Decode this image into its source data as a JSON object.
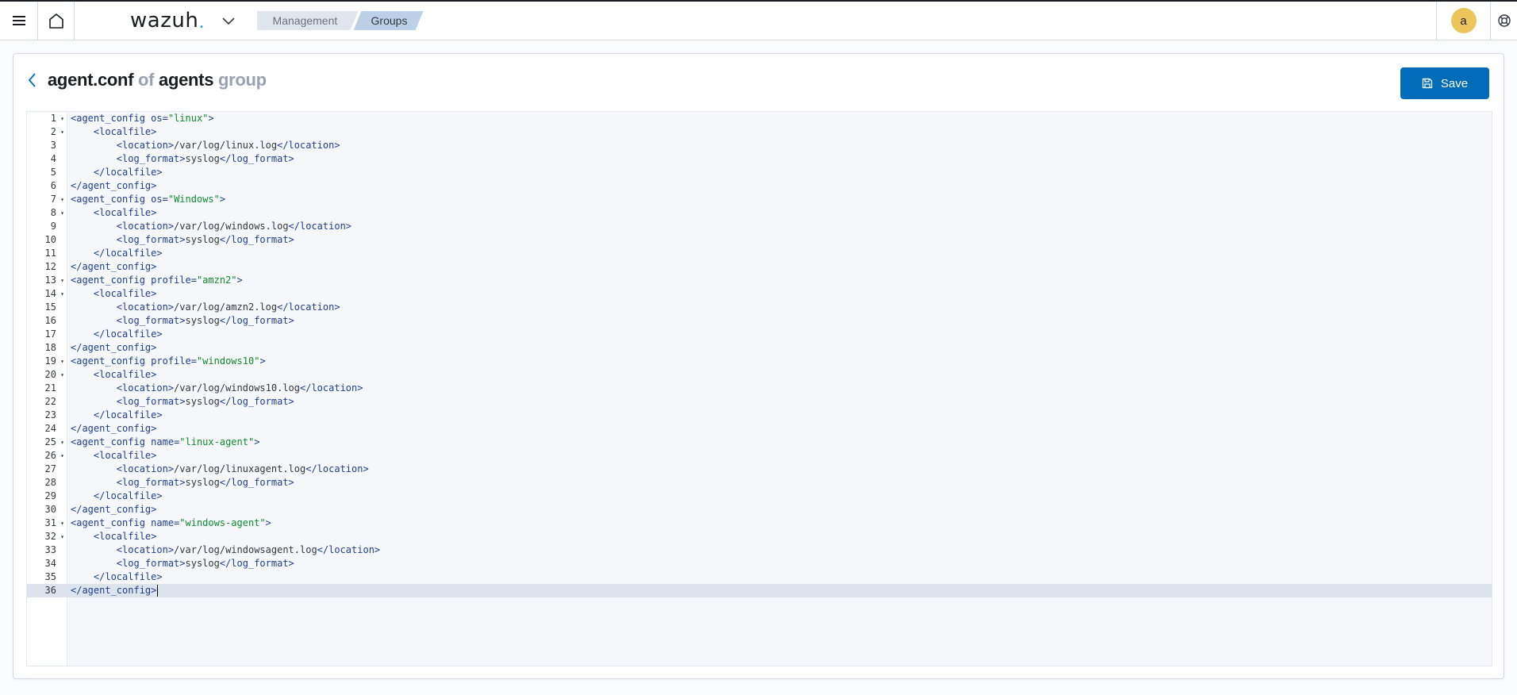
{
  "header": {
    "logo": "wazuh",
    "logo_dot": ".",
    "breadcrumbs": [
      "Management",
      "Groups"
    ],
    "avatar_letter": "a"
  },
  "page": {
    "title_file": "agent.conf",
    "title_of": "of",
    "title_group_name": "agents",
    "title_group": "group",
    "save_label": "Save"
  },
  "editor": {
    "active_line": 36,
    "lines": [
      "<agent_config os=\"linux\">",
      "    <localfile>",
      "        <location>/var/log/linux.log</location>",
      "        <log_format>syslog</log_format>",
      "    </localfile>",
      "</agent_config>",
      "<agent_config os=\"Windows\">",
      "    <localfile>",
      "        <location>/var/log/windows.log</location>",
      "        <log_format>syslog</log_format>",
      "    </localfile>",
      "</agent_config>",
      "<agent_config profile=\"amzn2\">",
      "    <localfile>",
      "        <location>/var/log/amzn2.log</location>",
      "        <log_format>syslog</log_format>",
      "    </localfile>",
      "</agent_config>",
      "<agent_config profile=\"windows10\">",
      "    <localfile>",
      "        <location>/var/log/windows10.log</location>",
      "        <log_format>syslog</log_format>",
      "    </localfile>",
      "</agent_config>",
      "<agent_config name=\"linux-agent\">",
      "    <localfile>",
      "        <location>/var/log/linuxagent.log</location>",
      "        <log_format>syslog</log_format>",
      "    </localfile>",
      "</agent_config>",
      "<agent_config name=\"windows-agent\">",
      "    <localfile>",
      "        <location>/var/log/windowsagent.log</location>",
      "        <log_format>syslog</log_format>",
      "    </localfile>",
      "</agent_config>"
    ],
    "fold_lines": [
      1,
      2,
      7,
      8,
      13,
      14,
      19,
      20,
      25,
      26,
      31,
      32
    ]
  },
  "colors": {
    "accent": "#006bb8",
    "avatar": "#ecc65b",
    "logo_dot": "#3595f9"
  }
}
